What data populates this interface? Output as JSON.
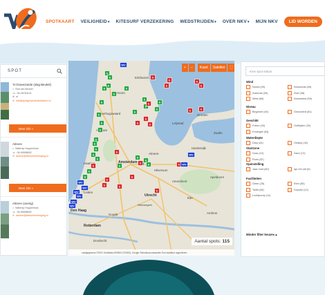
{
  "nav": {
    "items": [
      {
        "label": "SPOTKAART",
        "caret": false,
        "active": true
      },
      {
        "label": "VEILIGHEID",
        "caret": true,
        "active": false
      },
      {
        "label": "KITESURF VERZEKERING",
        "caret": false,
        "active": false
      },
      {
        "label": "WEDSTRIJDEN",
        "caret": true,
        "active": false
      },
      {
        "label": "OVER NKV",
        "caret": true,
        "active": false
      },
      {
        "label": "MIJN NKV",
        "caret": false,
        "active": false
      }
    ],
    "cta": "LID WORDEN",
    "caret_glyph": "▾"
  },
  "sidebar": {
    "search_label": "SPOT",
    "cards": [
      {
        "title": "'S-Gravezande (slag Beukel)",
        "lines": [
          "Strd van Beukel",
          "06-28764141",
          "nl",
          "info@spotgravezandekitesurf.nl"
        ],
        "more": "Meer info »"
      },
      {
        "title": "Almere",
        "lines": [
          "Watersp Hoppenhuis",
          "06-95558592",
          "almere@kitesurfvereniging.nl"
        ],
        "more": "Meer info »"
      },
      {
        "title": "Almere (overig)",
        "lines": [
          "Watersp Hoppenhuis",
          "06-95558592",
          "almere@kitesurfvereniging.nl"
        ],
        "more": "Meer info »"
      }
    ]
  },
  "map": {
    "controls": {
      "plus": "+",
      "minus": "−",
      "kaart": "Kaart",
      "satelliet": "Satelliet",
      "fullscreen": "⛶"
    },
    "count_label": "Aantal spots:",
    "count_value": "115",
    "google": "Google",
    "attribution": "Kaartgegevens ©2021 GeoBasis-DE/BKG (©2009), Google   Gebruiksvoorwaarden   Een kaartfout rapporteren",
    "places": [
      "Heerhugowaard",
      "Hoorn",
      "Enkhuizen",
      "Alkmaar",
      "Lelystad",
      "Haarlem",
      "Amsterdam",
      "Almere",
      "Leiden",
      "Utrecht",
      "Den Haag",
      "Rotterdam",
      "Gouda",
      "Amersfoort",
      "Apeldoorn",
      "Arnhem",
      "Dordrecht",
      "Nieuwegein",
      "Zwolle",
      "Ede",
      "Hilversum",
      "Harderwijk",
      "Dronten"
    ],
    "pin_colors": {
      "green": "#29a745",
      "red": "#d62b2b",
      "blue": "#1a3fd0"
    },
    "pin_glyph": "k",
    "wv_label": "WV"
  },
  "filters": {
    "status_placeholder": "Kies spot status",
    "sections": [
      {
        "name": "Wind",
        "options": [
          "Noord (49)",
          "Noordoost (26)",
          "Zuidoost (26)",
          "Zuid (38)",
          "West (66)",
          "Noordwest (59)"
        ]
      },
      {
        "name": "Niveau",
        "options": [
          "Beginner (40)",
          "Gevorderd (81)"
        ]
      },
      {
        "name": "Geschikt",
        "options": [
          "Foilen (40)",
          "Golfrijden (30)",
          "Freestyle (53)"
        ]
      },
      {
        "name": "Waterdiepte",
        "options": [
          "Diep (44)",
          "Ondiep (40)"
        ]
      },
      {
        "name": "Startzone",
        "options": [
          "Gras (19)",
          "Zand (72)",
          "Ruim (32)"
        ]
      },
      {
        "name": "Openstelling",
        "options": [
          "Jaar rond (80)",
          "apr t/m okt (6)"
        ]
      },
      {
        "name": "Faciliteiten",
        "options": [
          "Geen (28)",
          "Eten (55)",
          "Toilet (48)",
          "Douche (12)",
          "Luchtpomp (11)"
        ]
      }
    ],
    "fewer_label": "Minder filter keuzes ▴"
  },
  "colors": {
    "accent": "#ef6c1e",
    "navy": "#2b4a6c",
    "teal": "#0d4f57"
  }
}
